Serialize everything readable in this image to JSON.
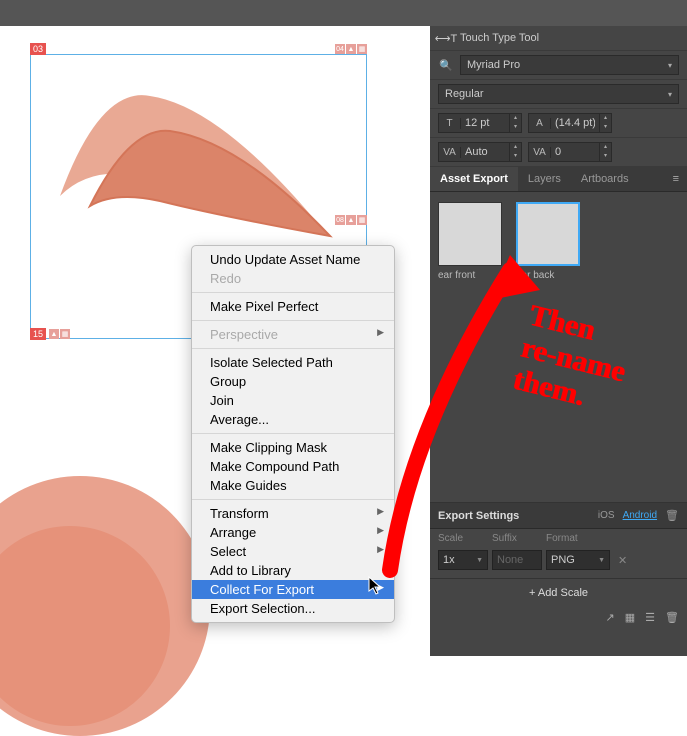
{
  "topbar": {},
  "artboards": {
    "a03": {
      "num": "03",
      "right_num": "04"
    },
    "a08": {
      "right_num": "08"
    },
    "a15": {
      "num": "15"
    }
  },
  "context_menu": {
    "undo": "Undo Update Asset Name",
    "redo": "Redo",
    "pixel_perfect": "Make Pixel Perfect",
    "perspective": "Perspective",
    "isolate": "Isolate Selected Path",
    "group": "Group",
    "join": "Join",
    "average": "Average...",
    "clip": "Make Clipping Mask",
    "compound": "Make Compound Path",
    "guides": "Make Guides",
    "transform": "Transform",
    "arrange": "Arrange",
    "select": "Select",
    "add_lib": "Add to Library",
    "collect": "Collect For Export",
    "export_sel": "Export Selection..."
  },
  "panel": {
    "touch_type": "Touch Type Tool",
    "font": "Myriad Pro",
    "style": "Regular",
    "size": "12 pt",
    "leading": "(14.4 pt)",
    "kerning": "Auto",
    "tracking": "0",
    "tabs": {
      "asset_export": "Asset Export",
      "layers": "Layers",
      "artboards": "Artboards"
    },
    "assets": [
      {
        "name": "ear front",
        "selected": false
      },
      {
        "name": "ear back",
        "selected": true
      }
    ],
    "export": {
      "title": "Export Settings",
      "ios": "iOS",
      "android": "Android",
      "col_scale": "Scale",
      "col_suffix": "Suffix",
      "col_format": "Format",
      "scale": "1x",
      "suffix": "None",
      "format": "PNG",
      "add_scale": "+   Add Scale"
    }
  },
  "annotation": {
    "text": "Then\nre-name\nthem."
  }
}
